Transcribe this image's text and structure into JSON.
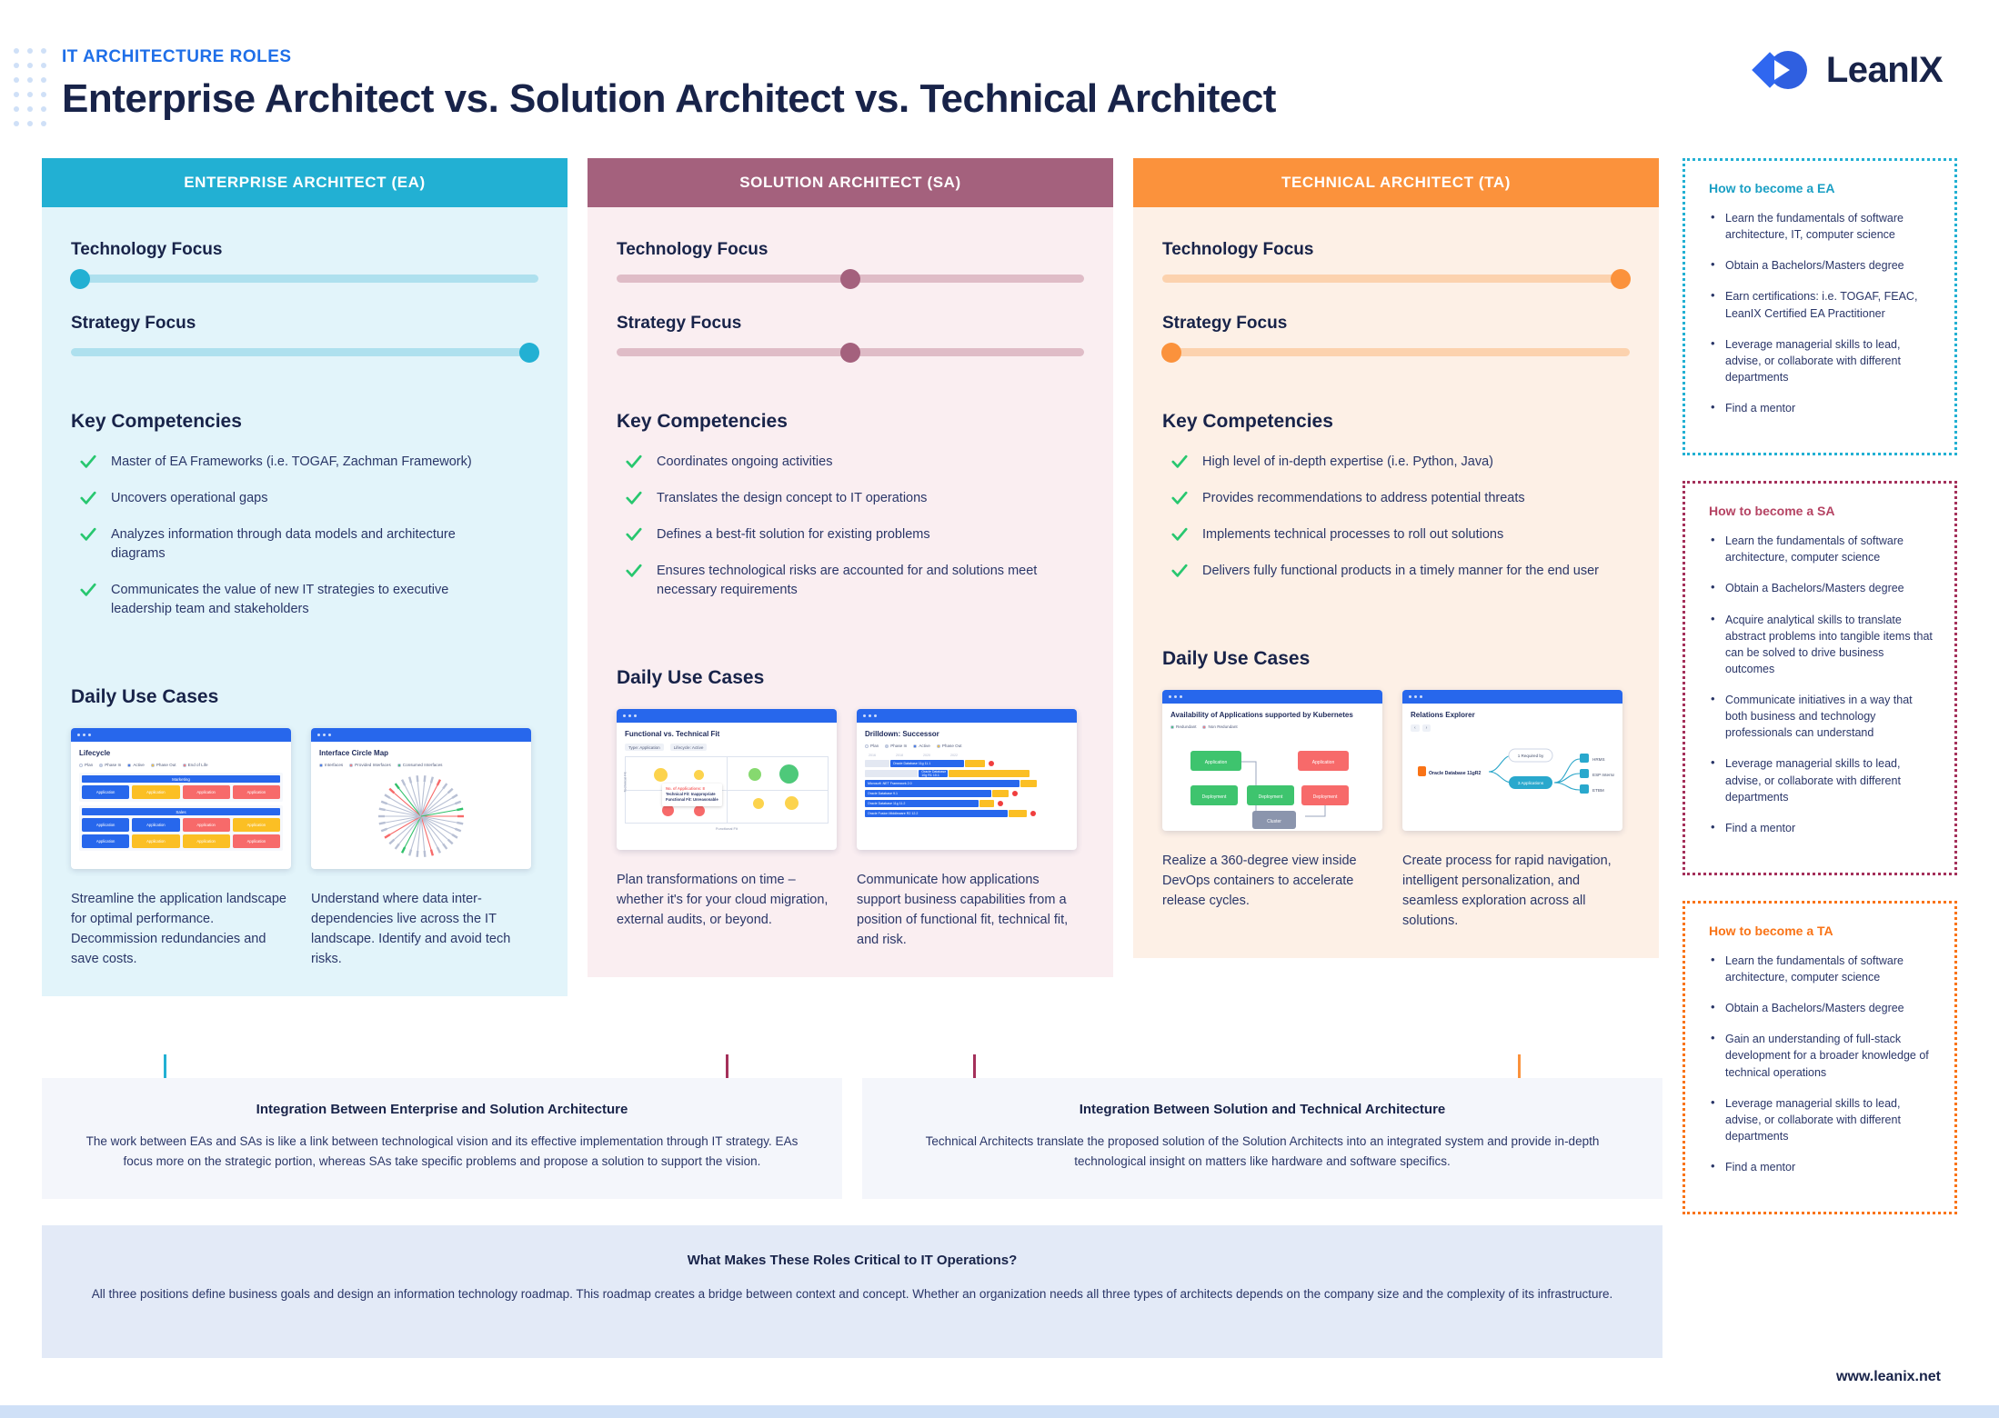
{
  "header": {
    "kicker": "IT ARCHITECTURE ROLES",
    "title": "Enterprise Architect vs. Solution Architect vs. Technical Architect",
    "logo_text": "LeanIX"
  },
  "columns": [
    {
      "key": "ea",
      "heading": "ENTERPRISE ARCHITECT (EA)",
      "accent": "#22b0d3",
      "track": "#aee0ee",
      "bg": "#e2f4fa",
      "focus": [
        {
          "label": "Technology Focus",
          "value": 2
        },
        {
          "label": "Strategy Focus",
          "value": 98
        }
      ],
      "competencies_title": "Key Competencies",
      "competencies": [
        "Master of EA Frameworks (i.e. TOGAF, Zachman Framework)",
        "Uncovers operational gaps",
        "Analyzes information through data models and architecture diagrams",
        "Communicates the value of new IT strategies to executive leadership team and stakeholders"
      ],
      "usecases_title": "Daily Use Cases",
      "usecases": [
        {
          "screenshot_title": "Lifecycle",
          "legend": [
            {
              "label": "Plan",
              "color": "#ffffff"
            },
            {
              "label": "Phase In",
              "color": "#c9d3e8"
            },
            {
              "label": "Active",
              "color": "#2767ec"
            },
            {
              "label": "Phase Out",
              "color": "#fbbf24"
            },
            {
              "label": "End of Life",
              "color": "#f76a6a"
            }
          ],
          "groups": [
            {
              "name": "Marketing",
              "tiles": [
                "blue",
                "amber",
                "red",
                "red"
              ]
            },
            {
              "name": "Sales",
              "tiles": [
                "blue",
                "blue",
                "red",
                "amber",
                "blue",
                "amber",
                "amber",
                "red"
              ]
            }
          ],
          "tile_label": "Application",
          "caption": "Streamline the application landscape for optimal performance. Decommission redundancies and save costs."
        },
        {
          "screenshot_title": "Interface Circle Map",
          "legend": [
            {
              "label": "Interfaces",
              "color": "#2767ec"
            },
            {
              "label": "Provided Interfaces",
              "color": "#f76a6a"
            },
            {
              "label": "Consumed Interfaces",
              "color": "#30c06a"
            }
          ],
          "caption": "Understand where data inter-dependencies live across the IT landscape. Identify and avoid tech risks."
        }
      ]
    },
    {
      "key": "sa",
      "heading": "SOLUTION ARCHITECT (SA)",
      "accent": "#a4617d",
      "track": "#dfbcc7",
      "bg": "#faeef1",
      "focus": [
        {
          "label": "Technology Focus",
          "value": 50
        },
        {
          "label": "Strategy Focus",
          "value": 50
        }
      ],
      "competencies_title": "Key Competencies",
      "competencies": [
        "Coordinates ongoing activities",
        "Translates the design concept to IT operations",
        "Defines a best-fit solution for existing problems",
        "Ensures technological risks are accounted for and solutions meet necessary requirements"
      ],
      "usecases_title": "Daily Use Cases",
      "usecases": [
        {
          "screenshot_title": "Functional vs. Technical Fit",
          "chips": [
            "Type: Application",
            "Lifecycle: Active"
          ],
          "tooltip": [
            "No. of Applications: 8",
            "Technical Fit: Inappropriate",
            "Functional Fit: Unreasonable"
          ],
          "axis_y": "Technical Fit",
          "axis_x": "Functional Fit",
          "caption": "Plan transformations on time – whether it's for your cloud migration, external audits, or beyond."
        },
        {
          "screenshot_title": "Drilldown: Successor",
          "legend": [
            {
              "label": "Plan",
              "color": "#ffffff"
            },
            {
              "label": "Phase In",
              "color": "#c9d3e8"
            },
            {
              "label": "Active",
              "color": "#2767ec"
            },
            {
              "label": "Phase Out",
              "color": "#fbbf24"
            }
          ],
          "rows": [
            "Oracle Database 11g 11.1",
            "Oracle Database 10g R1 10.1",
            "Microsoft .NET Framework 2.0",
            "Oracle Database 9.1",
            "Oracle Database 11g 11.2",
            "Oracle Fusion Middleware R2 12.2"
          ],
          "caption": "Communicate how applications support business capabilities from a position of functional fit, technical fit, and risk."
        }
      ]
    },
    {
      "key": "ta",
      "heading": "TECHNICAL ARCHITECT (TA)",
      "accent": "#fb923c",
      "track": "#fcd2ae",
      "bg": "#fdf0e6",
      "focus": [
        {
          "label": "Technology Focus",
          "value": 98
        },
        {
          "label": "Strategy Focus",
          "value": 2
        }
      ],
      "competencies_title": "Key Competencies",
      "competencies": [
        "High level of in-depth expertise (i.e. Python, Java)",
        "Provides recommendations to address potential threats",
        "Implements technical processes to roll out solutions",
        "Delivers fully functional products in a timely manner for the end user"
      ],
      "usecases_title": "Daily Use Cases",
      "usecases": [
        {
          "screenshot_title": "Availability of Applications supported by Kubernetes",
          "legend": [
            {
              "label": "Redundant",
              "color": "#30c06a"
            },
            {
              "label": "Non Redundant",
              "color": "#f76a6a"
            }
          ],
          "nodes": [
            "Application",
            "Application",
            "Deployment",
            "Deployment",
            "Deployment",
            "Cluster"
          ],
          "caption": "Realize a 360-degree view inside DevOps containers to accelerate release cycles."
        },
        {
          "screenshot_title": "Relations Explorer",
          "root_node": "Oracle Database 11gR2",
          "branches": [
            "1 Required by",
            "3 Applications"
          ],
          "leaves": [
            "HRMS",
            "ESP Internal",
            "ETBM"
          ],
          "caption": "Create process for rapid navigation, intelligent personalization, and seamless exploration across all solutions."
        }
      ]
    }
  ],
  "integrations": [
    {
      "title": "Integration Between Enterprise and Solution Architecture",
      "body": "The work between EAs and SAs is like a link between technological vision and its effective implementation through IT strategy. EAs focus more on the strategic portion, whereas SAs take specific problems and propose a solution to support the vision."
    },
    {
      "title": "Integration Between Solution and Technical Architecture",
      "body": "Technical Architects translate the proposed solution of the Solution Architects into an integrated system and provide in-depth technological insight on matters like hardware and software specifics."
    }
  ],
  "critical": {
    "title": "What Makes These Roles Critical to IT Operations?",
    "body": "All three positions define business goals and design an information technology roadmap. This roadmap creates a bridge between context and concept. Whether an organization needs all three types of architects depends on the company size and the complexity of its infrastructure."
  },
  "sidebar": [
    {
      "key": "ea",
      "title": "How to become a EA",
      "color": "#1a9fc4",
      "items": [
        "Learn the fundamentals of software architecture, IT, computer science",
        "Obtain a Bachelors/Masters degree",
        "Earn certifications: i.e. TOGAF, FEAC, LeanIX Certified EA Practitioner",
        "Leverage managerial skills to lead, advise, or collaborate with different departments",
        "Find a mentor"
      ]
    },
    {
      "key": "sa",
      "title": "How to become a SA",
      "color": "#b54363",
      "items": [
        "Learn the fundamentals of software architecture, computer science",
        "Obtain a Bachelors/Masters degree",
        "Acquire analytical skills to translate abstract problems into tangible items that can be solved to drive business outcomes",
        "Communicate initiatives in a way that both business and technology professionals can understand",
        "Leverage managerial skills to lead, advise, or collaborate with different departments",
        "Find a mentor"
      ]
    },
    {
      "key": "ta",
      "title": "How to become a TA",
      "color": "#f97316",
      "items": [
        "Learn the fundamentals of software architecture, computer science",
        "Obtain a Bachelors/Masters degree",
        "Gain an understanding of full-stack development for a broader knowledge of technical operations",
        "Leverage managerial skills to lead, advise, or collaborate with different departments",
        "Find a mentor"
      ]
    }
  ],
  "footer": {
    "url": "www.leanix.net"
  }
}
